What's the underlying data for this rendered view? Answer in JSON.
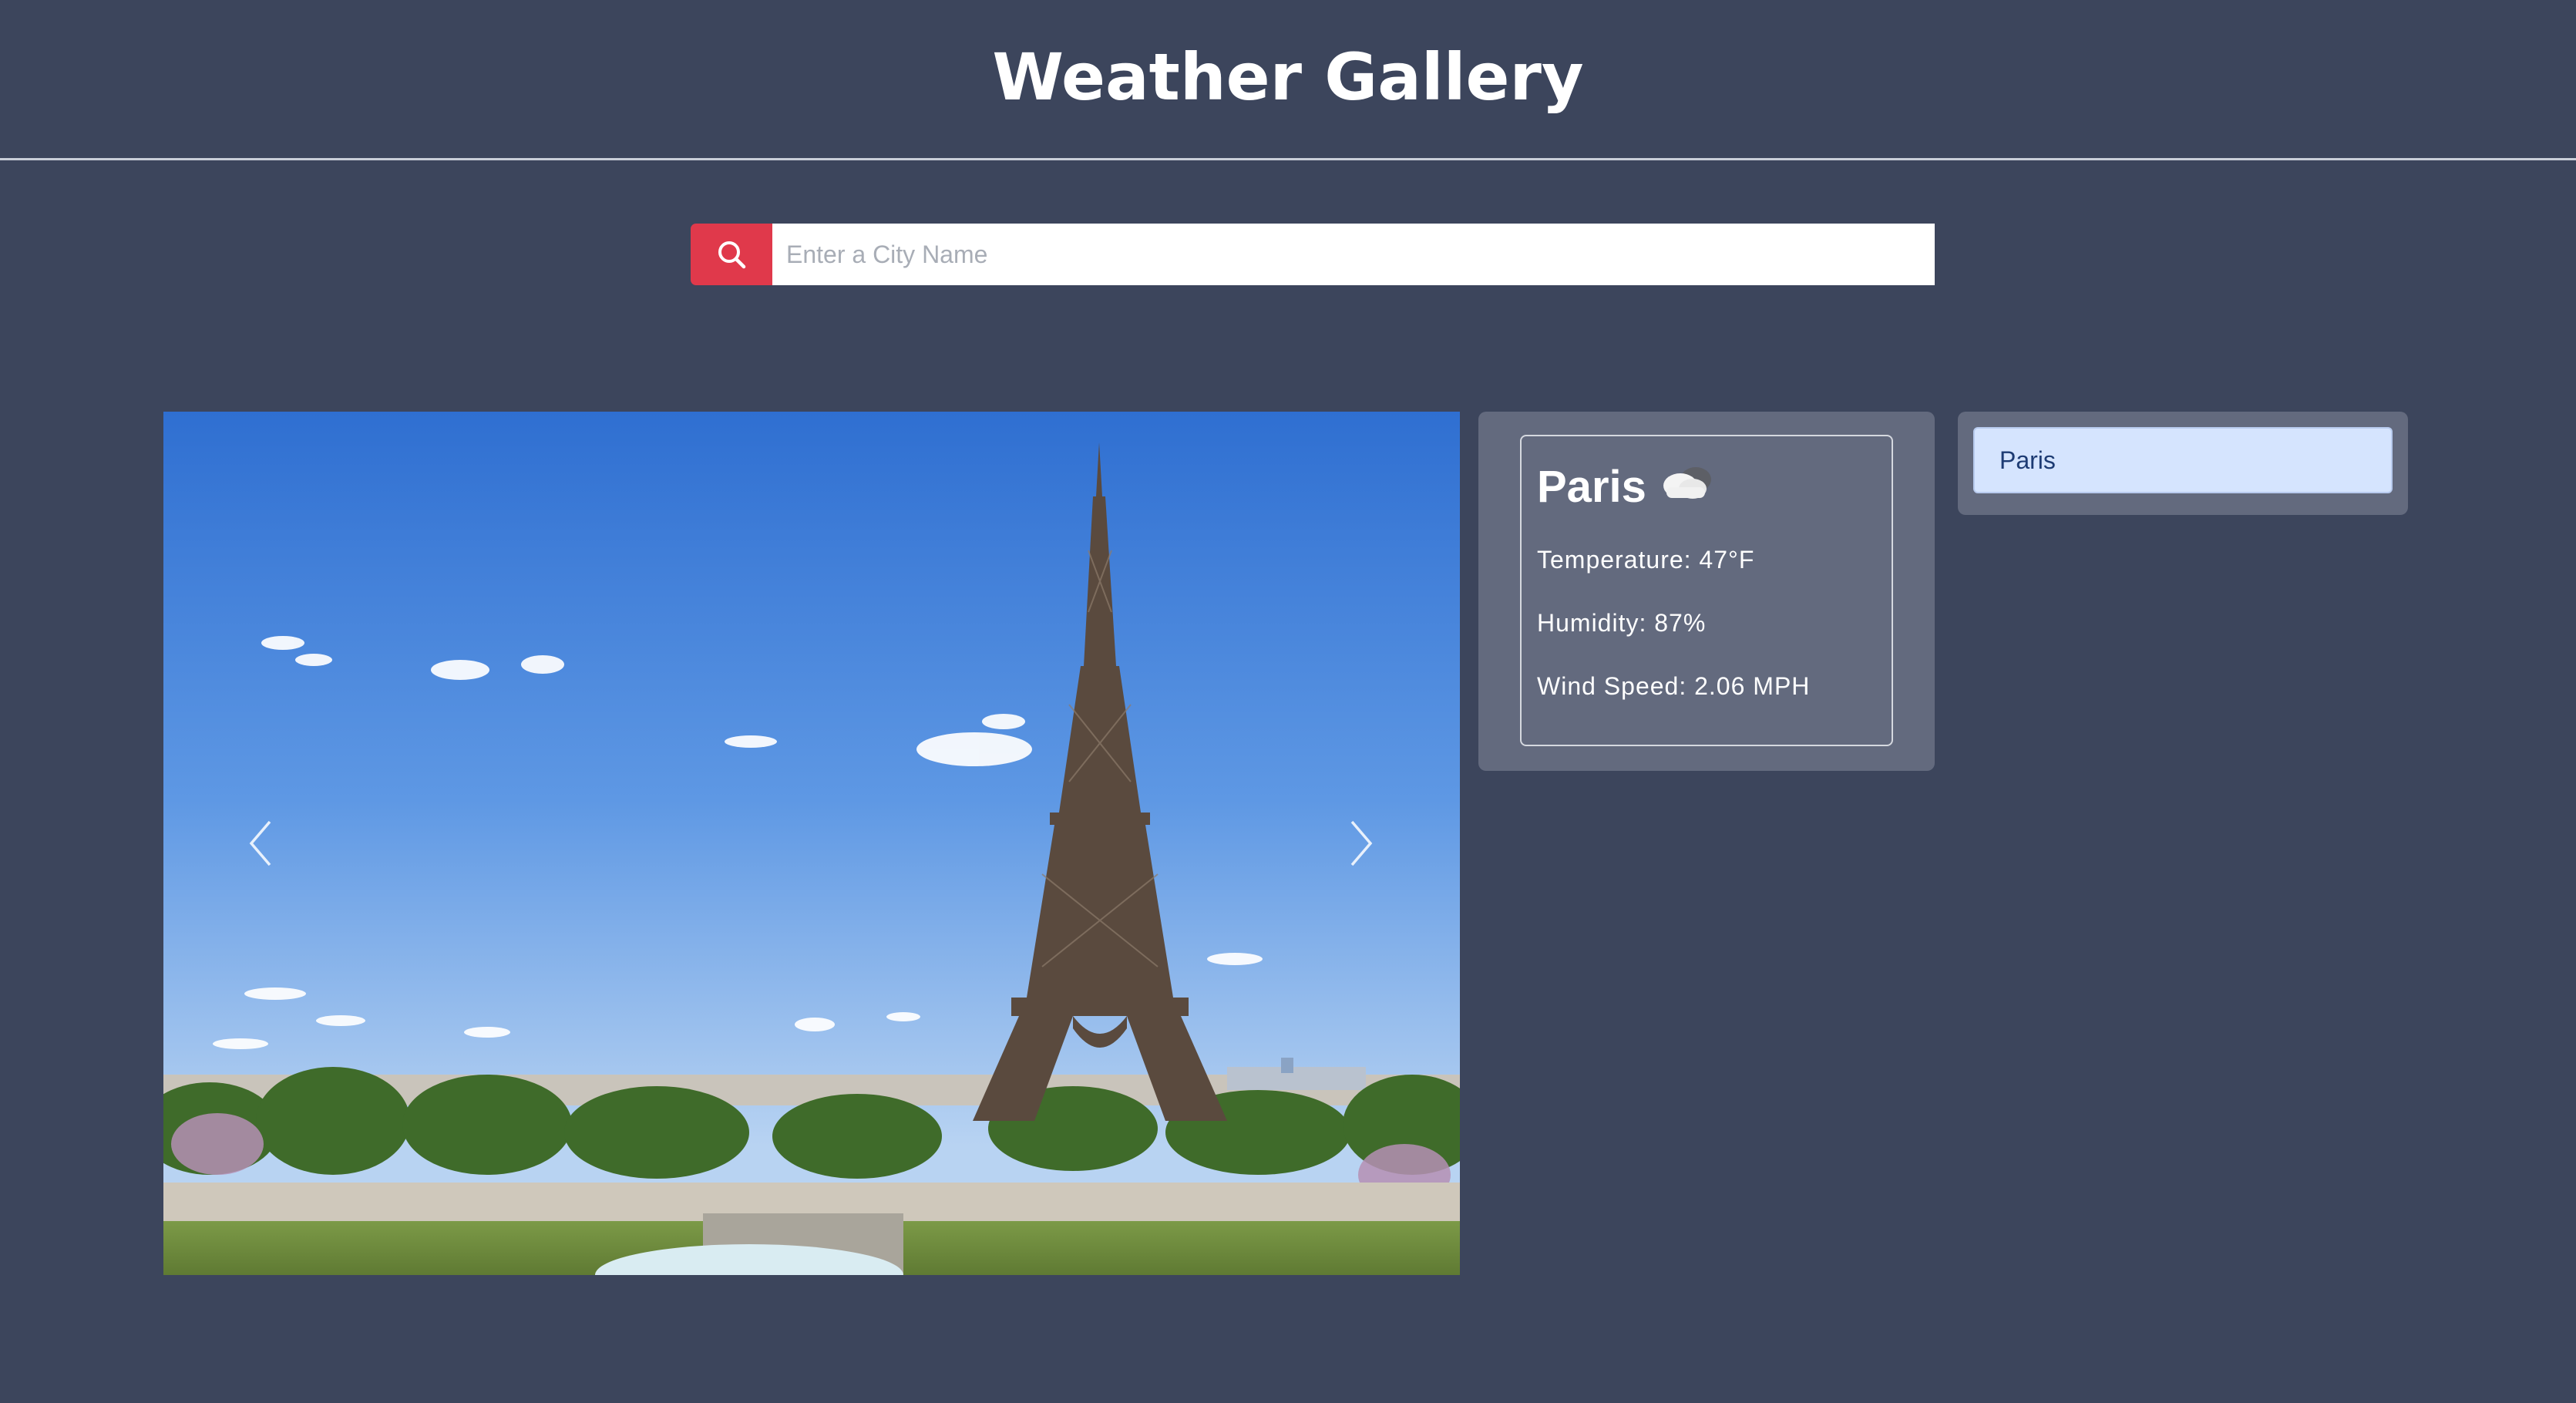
{
  "app": {
    "title": "Weather Gallery"
  },
  "search": {
    "placeholder": "Enter a City Name",
    "value": "",
    "button_icon": "search-icon",
    "button_color": "#e0394b"
  },
  "carousel": {
    "image_subject": "Eiffel Tower, Paris",
    "prev_icon": "chevron-left-icon",
    "next_icon": "chevron-right-icon"
  },
  "weather": {
    "city": "Paris",
    "icon": "cloud-icon",
    "temperature": "Temperature: 47°F",
    "humidity": "Humidity: 87%",
    "wind_speed": "Wind Speed: 2.06 MPH"
  },
  "history": {
    "items": [
      {
        "label": "Paris"
      }
    ]
  },
  "colors": {
    "background": "#3c455c",
    "panel": "#636a7e",
    "accent": "#e0394b",
    "history_item": "#d5e4fe"
  }
}
